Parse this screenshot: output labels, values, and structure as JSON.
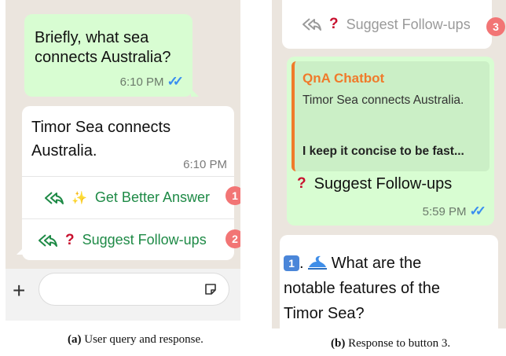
{
  "panel_a": {
    "user_message": "Briefly, what sea connects Australia?",
    "user_time": "6:10 PM",
    "bot_message": "Timor Sea connects Australia.",
    "bot_time": "6:10 PM",
    "buttons": [
      {
        "label": "Get Better Answer",
        "icon": "sparkle-icon",
        "badge": "1"
      },
      {
        "label": "Suggest Follow-ups",
        "icon": "question-mark-icon",
        "badge": "2"
      }
    ],
    "caption_label": "(a)",
    "caption_text": "User query and response."
  },
  "panel_b": {
    "top_button": {
      "label": "Suggest Follow-ups",
      "badge": "3"
    },
    "quoted": {
      "sender": "QnA Chatbot",
      "line1": "Timor Sea connects Australia.",
      "line2": "I keep it concise to be fast..."
    },
    "follow_label": "Suggest Follow-ups",
    "time": "5:59 PM",
    "followup_number": "1",
    "followup_question": ". 🌊 What are the notable features of the Timor Sea?",
    "followup_q_part1": "What are the",
    "followup_q_part2": "notable features of the",
    "followup_q_part3": "Timor Sea?",
    "caption_label": "(b)",
    "caption_text": "Response to button 3."
  },
  "colors": {
    "chat_bg": "#ebe5de",
    "user_bubble": "#d8fdd2",
    "button_text": "#1e8a46",
    "badge": "#f27575",
    "quote_accent": "#f07a2a",
    "read_ticks": "#3a8ef0"
  }
}
